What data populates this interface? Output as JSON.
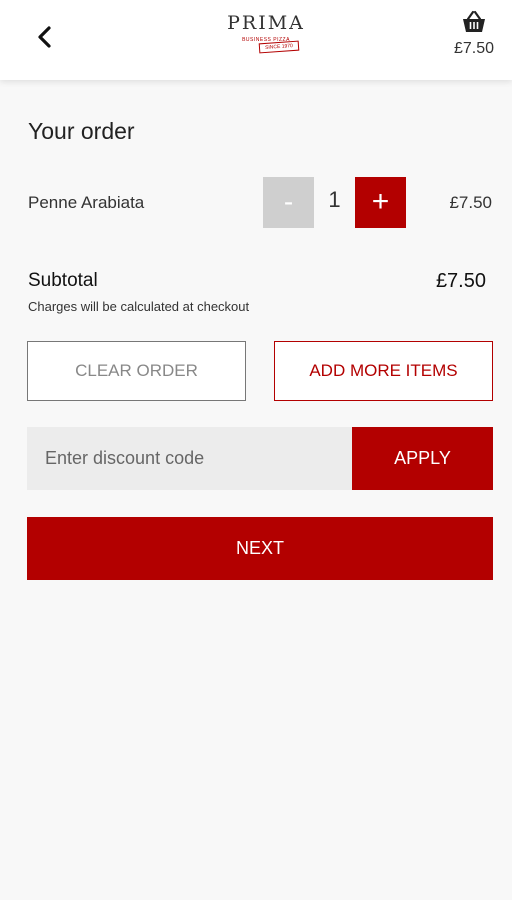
{
  "header": {
    "logo": {
      "name": "PRIMA",
      "subtitle": "BUSINESS PIZZA",
      "stamp": "SINCE 1970"
    },
    "cart_total": "£7.50",
    "back_icon": "chevron-left-icon",
    "cart_icon": "basket-icon"
  },
  "order": {
    "title": "Your order",
    "items": [
      {
        "name": "Penne Arabiata",
        "quantity": "1",
        "price": "£7.50",
        "decrement_label": "-",
        "increment_label": "+"
      }
    ],
    "subtotal_label": "Subtotal",
    "subtotal_value": "£7.50",
    "charges_note": "Charges will be calculated at checkout"
  },
  "actions": {
    "clear_label": "CLEAR ORDER",
    "add_more_label": "ADD MORE ITEMS",
    "discount_placeholder": "Enter discount code",
    "discount_value": "",
    "apply_label": "APPLY",
    "next_label": "NEXT"
  },
  "colors": {
    "accent": "#b30000",
    "disabled": "#cfcfcf",
    "background": "#f8f8f8"
  }
}
